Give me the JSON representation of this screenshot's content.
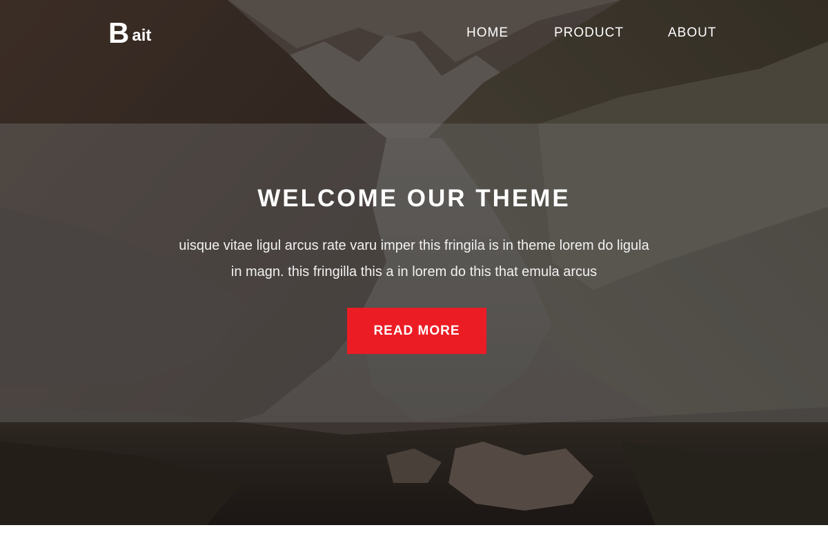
{
  "header": {
    "logo_initial": "B",
    "logo_rest": "ait",
    "nav": [
      {
        "label": "HOME"
      },
      {
        "label": "PRODUCT"
      },
      {
        "label": "ABOUT"
      }
    ]
  },
  "hero": {
    "title": "WELCOME OUR THEME",
    "text_line1": "uisque vitae ligul arcus rate varu imper this fringila is in theme lorem do ligula",
    "text_line2": "in magn. this fringilla this a in lorem do this that emula arcus",
    "button_label": "READ MORE",
    "background_image": "mountain-valley-village-photo"
  },
  "colors": {
    "accent": "#ec1c24",
    "text": "#ffffff",
    "page_background": "#ffffff"
  }
}
